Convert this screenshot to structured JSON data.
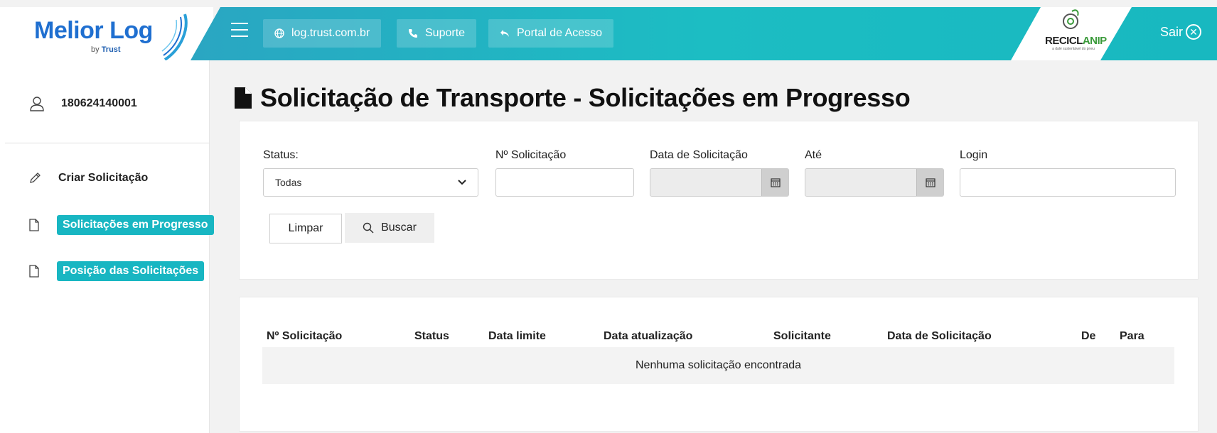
{
  "header": {
    "logo": {
      "title": "Melior Log",
      "sub_prefix": "by",
      "sub_brand": "Trust"
    },
    "links": [
      {
        "label": "log.trust.com.br",
        "icon": "globe-icon"
      },
      {
        "label": "Suporte",
        "icon": "phone-icon"
      },
      {
        "label": "Portal de Acesso",
        "icon": "reply-arrow-icon"
      }
    ],
    "partner": {
      "name_a": "RECICL",
      "name_b": "ANIP",
      "tagline": "a dalé sustentável do pneu"
    },
    "logout_label": "Sair"
  },
  "sidebar": {
    "user_id": "180624140001",
    "items": [
      {
        "label": "Criar Solicitação",
        "icon": "pencil-icon"
      },
      {
        "label": "Solicitações em Progresso",
        "icon": "document-icon"
      },
      {
        "label": "Posição das Solicitações",
        "icon": "document-icon"
      }
    ]
  },
  "main": {
    "title": "Solicitação de Transporte - Solicitações em Progresso",
    "filters": {
      "status_label": "Status:",
      "status_value": "Todas",
      "numero_label": "Nº Solicitação",
      "numero_value": "",
      "data_label": "Data de Solicitação",
      "ate_label": "Até",
      "login_label": "Login",
      "login_value": ""
    },
    "buttons": {
      "clear": "Limpar",
      "search": "Buscar"
    },
    "table": {
      "columns": [
        "Nº Solicitação",
        "Status",
        "Data limite",
        "Data atualização",
        "Solicitante",
        "Data de Solicitação",
        "De",
        "Para"
      ],
      "empty_message": "Nenhuma solicitação encontrada"
    }
  },
  "colors": {
    "accent": "#18b6c2",
    "brand_blue": "#1f6fd0",
    "partner_green": "#3a9a3a"
  }
}
